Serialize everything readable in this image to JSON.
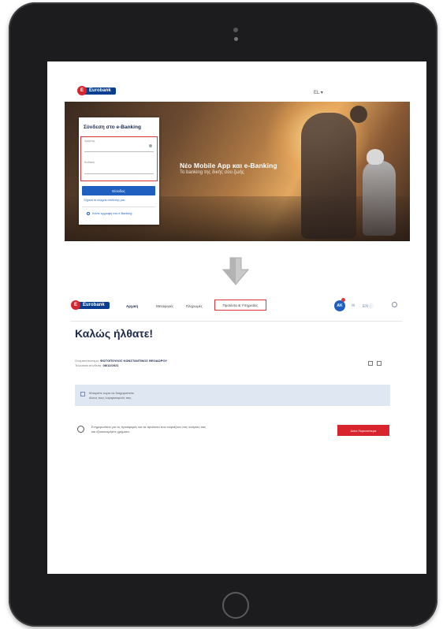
{
  "top_logo": {
    "badge": "E",
    "name": "Eurobank"
  },
  "top_lang": "EL ▾",
  "hero": {
    "title": "Νέο Mobile App και e-Banking",
    "subtitle": "Το banking της δικής σου ζωής"
  },
  "login": {
    "title": "Σύνδεση στο e-Banking",
    "username_label": "Χρήστης",
    "password_label": "Κωδικός",
    "submit_label": "Είσοδος",
    "forgot_label": "Ξέχασα τα στοιχεία σύνδεσης μου",
    "signup_label": "Κάντε εγγραφή στο e-Banking"
  },
  "nav": {
    "logo_badge": "E",
    "logo_name": "Eurobank",
    "items": [
      "Αρχική",
      "Μεταφορές",
      "Πληρωμές"
    ],
    "highlighted": "Προϊόντα & Υπηρεσίες",
    "user_initials": "AK",
    "mail_icon": "✉",
    "lang": "EN ⓘ",
    "search_icon": "search-icon"
  },
  "welcome": "Καλώς ήλθατε!",
  "info": {
    "line1_label": "Ονοματεπώνυμο:",
    "line1_value": "ΦΩΤΟΠΟΥΛΟΣ ΚΩΝΣΤΑΝΤΙΝΟΣ ΘΕΟΔΩΡΟΥ",
    "line2_label": "Τελευταία σύνδεση:",
    "line2_value": "08/12/2021"
  },
  "notice": {
    "line1": "Μπορείτε τώρα να διαχειριστείτε",
    "line2": "όλους τους λογαριασμούς σας"
  },
  "promo": {
    "line1": "Ενημερωθείτε για τις προσφορές και τα προϊόντα που ταιριάζουν στις ανάγκες σας",
    "line2": "και εξοικονομήστε χρήματα.",
    "button": "Δείτε Περισσότερα"
  },
  "colors": {
    "brand_blue": "#0a3f8f",
    "accent_red": "#d8242c",
    "link_blue": "#1f5fbf",
    "notice_bg": "#dfe8f2"
  }
}
